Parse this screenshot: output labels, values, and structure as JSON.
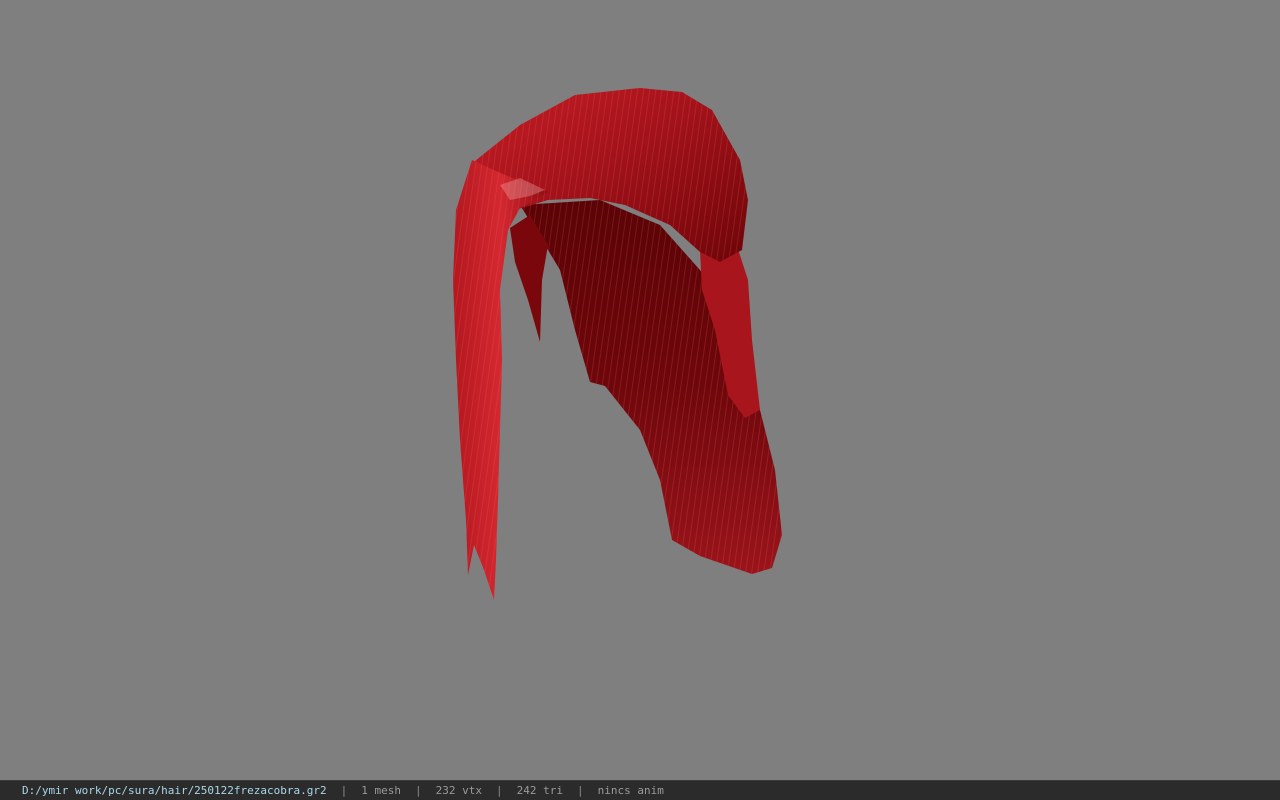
{
  "viewer": {
    "background_color": "#7f7f7f",
    "model": {
      "icon": "hair-mesh",
      "color_base": "#8b0a0d",
      "color_highlight": "#d8323a",
      "color_shadow": "#4a0204"
    }
  },
  "status_bar": {
    "file_path": "D:/ymir work/pc/sura/hair/250122frezacobra.gr2",
    "separator": "|",
    "mesh_count": "1 mesh",
    "vertex_count": "232 vtx",
    "triangle_count": "242 tri",
    "animation": "nincs anim"
  }
}
